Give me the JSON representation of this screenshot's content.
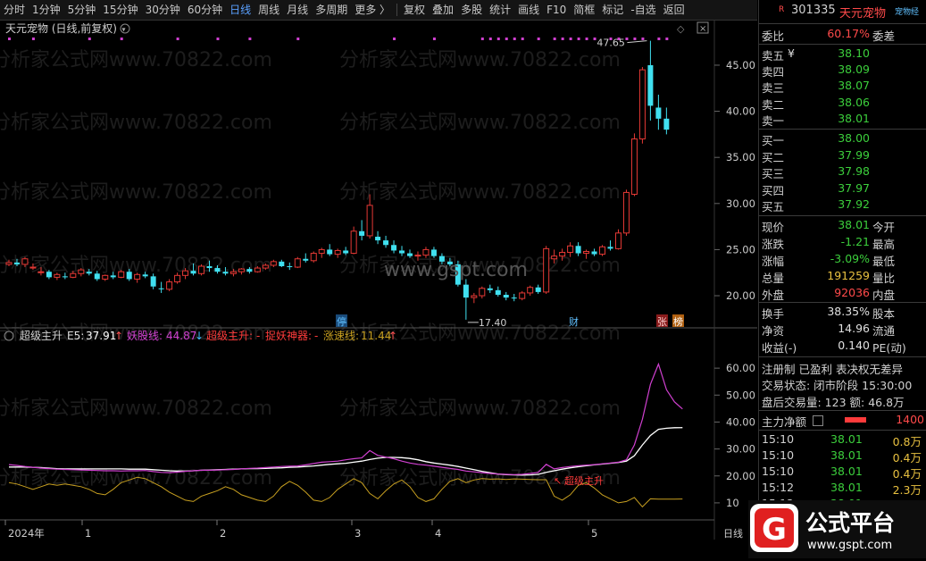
{
  "toolbar": {
    "items": [
      {
        "label": "分时",
        "active": false
      },
      {
        "label": "1分钟",
        "active": false
      },
      {
        "label": "5分钟",
        "active": false
      },
      {
        "label": "15分钟",
        "active": false
      },
      {
        "label": "30分钟",
        "active": false
      },
      {
        "label": "60分钟",
        "active": false
      },
      {
        "label": "日线",
        "active": true
      },
      {
        "label": "周线",
        "active": false
      },
      {
        "label": "月线",
        "active": false
      },
      {
        "label": "多周期",
        "active": false
      },
      {
        "label": "更多 〉",
        "active": false
      }
    ],
    "right_items": [
      "复权",
      "叠加",
      "多股",
      "统计",
      "画线",
      "F10",
      "简框",
      "标记",
      "-自选",
      "返回"
    ]
  },
  "chart_title": "天元宠物 (日线,前复权)",
  "watermark": "分析家公式网www.70822.com",
  "center_watermark": "www.gspt.com",
  "price_axis": [
    "45.00",
    "40.00",
    "35.00",
    "30.00",
    "25.00",
    "20.00"
  ],
  "high_label": "47.65",
  "low_label": "17.40",
  "markers": {
    "ting": "停",
    "cai": "财",
    "zhang": "张",
    "bang": "榜"
  },
  "indicator": {
    "name": "超级主升",
    "e5_label": "E5:",
    "e5_value": "37.91",
    "yao_label": "妖股线:",
    "yao_value": "44.87",
    "zs_label": "超级主升:",
    "zs_value": "-",
    "zy_label": "捉妖神器:",
    "zy_value": "-",
    "zs2_label": "涨速线:",
    "zs2_value": "11.44",
    "annotation": "超级主升",
    "axis": [
      "60.00",
      "50.00",
      "40.00",
      "30.00",
      "20.00",
      "10"
    ]
  },
  "date_axis": [
    "2024年",
    "1",
    "2",
    "3",
    "4",
    "5"
  ],
  "date_axis_right": "日线",
  "colors": {
    "up": "#e53935",
    "down": "#40e0f0",
    "bg": "#000000",
    "yao": "#d040d0",
    "e5": "#ffffff",
    "zsx": "#c8a020"
  },
  "sidebar": {
    "code": "301335",
    "name": "天元宠物",
    "r_badge": "R",
    "extra": "宠物经",
    "weibi_label": "委比",
    "weibi": "60.17%",
    "weicha_label": "委差",
    "asks": [
      {
        "label": "卖五",
        "mark": "¥",
        "price": "38.10"
      },
      {
        "label": "卖四",
        "mark": "",
        "price": "38.09"
      },
      {
        "label": "卖三",
        "mark": "",
        "price": "38.07"
      },
      {
        "label": "卖二",
        "mark": "",
        "price": "38.06"
      },
      {
        "label": "卖一",
        "mark": "",
        "price": "38.01"
      }
    ],
    "bids": [
      {
        "label": "买一",
        "price": "38.00"
      },
      {
        "label": "买二",
        "price": "37.99"
      },
      {
        "label": "买三",
        "price": "37.98"
      },
      {
        "label": "买四",
        "price": "37.97"
      },
      {
        "label": "买五",
        "price": "37.92"
      }
    ],
    "stats": [
      {
        "l": "现价",
        "v": "38.01",
        "c": "green",
        "r": "今开"
      },
      {
        "l": "涨跌",
        "v": "-1.21",
        "c": "green",
        "r": "最高"
      },
      {
        "l": "涨幅",
        "v": "-3.09%",
        "c": "green",
        "r": "最低"
      },
      {
        "l": "总量",
        "v": "191259",
        "c": "yellow",
        "r": "量比"
      },
      {
        "l": "外盘",
        "v": "92036",
        "c": "red",
        "r": "内盘"
      }
    ],
    "stats2": [
      {
        "l": "换手",
        "v": "38.35%",
        "c": "white",
        "r": "股本"
      },
      {
        "l": "净资",
        "v": "14.96",
        "c": "white",
        "r": "流通"
      },
      {
        "l": "收益(-)",
        "v": "0.140",
        "c": "white",
        "r": "PE(动)"
      }
    ],
    "reg_line": "注册制  已盈利  表决权无差异",
    "trade_state": "交易状态: 闭市阶段 15:30:00",
    "after_hours": "盘后交易量: 123   额: 46.8万",
    "main_flow_label": "主力净额",
    "main_flow_value": "1400",
    "ticks": [
      {
        "t": "15:10",
        "p": "38.01",
        "v": "0.8万"
      },
      {
        "t": "15:10",
        "p": "38.01",
        "v": "0.4万"
      },
      {
        "t": "15:10",
        "p": "38.01",
        "v": "0.4万"
      },
      {
        "t": "15:12",
        "p": "38.01",
        "v": "2.3万"
      },
      {
        "t": "15:12",
        "p": "38.01",
        "v": "0.8万"
      }
    ]
  },
  "logo": {
    "main": "公式平台",
    "url": "www.gspt.com",
    "glyph": "G"
  },
  "chart_data": {
    "type": "candlestick",
    "ylim": [
      17,
      48
    ],
    "ohlc": [
      [
        23.4,
        23.9,
        23.2,
        23.6
      ],
      [
        23.6,
        24.0,
        23.2,
        23.4
      ],
      [
        23.4,
        24.2,
        23.1,
        24.0
      ],
      [
        23.0,
        23.5,
        22.8,
        23.1
      ],
      [
        22.5,
        23.1,
        22.2,
        22.6
      ],
      [
        22.6,
        22.8,
        21.8,
        22.0
      ],
      [
        22.0,
        22.5,
        21.7,
        22.3
      ],
      [
        22.1,
        22.5,
        21.8,
        22.0
      ],
      [
        22.0,
        22.7,
        21.9,
        22.4
      ],
      [
        22.4,
        23.0,
        22.1,
        22.8
      ],
      [
        22.6,
        22.9,
        22.2,
        22.4
      ],
      [
        22.4,
        22.7,
        21.6,
        21.8
      ],
      [
        21.8,
        22.3,
        21.6,
        22.2
      ],
      [
        22.2,
        22.6,
        21.8,
        22.0
      ],
      [
        22.0,
        22.8,
        21.9,
        22.6
      ],
      [
        22.6,
        22.9,
        21.6,
        21.8
      ],
      [
        21.8,
        22.5,
        21.4,
        22.3
      ],
      [
        22.3,
        22.6,
        21.9,
        22.1
      ],
      [
        22.1,
        22.4,
        20.7,
        21.0
      ],
      [
        20.8,
        21.5,
        20.3,
        20.7
      ],
      [
        20.7,
        21.8,
        20.5,
        21.5
      ],
      [
        21.5,
        22.5,
        21.3,
        22.2
      ],
      [
        22.2,
        23.0,
        21.8,
        22.7
      ],
      [
        22.7,
        23.5,
        22.2,
        22.4
      ],
      [
        22.4,
        23.4,
        22.2,
        23.2
      ],
      [
        23.2,
        23.8,
        22.6,
        23.0
      ],
      [
        23.0,
        23.3,
        22.4,
        22.6
      ],
      [
        22.6,
        23.1,
        22.2,
        22.4
      ],
      [
        22.4,
        22.9,
        22.1,
        22.6
      ],
      [
        22.6,
        23.0,
        22.3,
        22.9
      ],
      [
        22.9,
        23.1,
        22.4,
        22.6
      ],
      [
        22.6,
        23.2,
        22.5,
        23.0
      ],
      [
        23.0,
        23.5,
        22.8,
        23.3
      ],
      [
        23.3,
        23.9,
        23.1,
        23.7
      ],
      [
        23.7,
        23.9,
        23.1,
        23.2
      ],
      [
        23.2,
        23.6,
        22.8,
        23.1
      ],
      [
        23.1,
        24.2,
        23.0,
        24.0
      ],
      [
        24.0,
        24.6,
        23.6,
        23.8
      ],
      [
        23.8,
        24.8,
        23.6,
        24.6
      ],
      [
        24.6,
        25.2,
        24.1,
        25.0
      ],
      [
        25.0,
        25.6,
        24.3,
        24.5
      ],
      [
        24.5,
        25.1,
        24.1,
        24.9
      ],
      [
        24.9,
        25.3,
        24.4,
        24.6
      ],
      [
        24.6,
        27.5,
        24.5,
        27.0
      ],
      [
        27.0,
        28.2,
        26.0,
        26.5
      ],
      [
        26.5,
        31.0,
        26.2,
        29.8
      ],
      [
        26.4,
        27.0,
        25.6,
        26.0
      ],
      [
        26.0,
        26.5,
        25.2,
        25.5
      ],
      [
        25.5,
        26.0,
        24.6,
        24.9
      ],
      [
        24.9,
        25.4,
        24.3,
        24.6
      ],
      [
        24.6,
        25.0,
        24.1,
        24.3
      ],
      [
        24.3,
        24.8,
        23.8,
        24.4
      ],
      [
        24.4,
        25.3,
        24.1,
        25.0
      ],
      [
        25.0,
        25.3,
        24.1,
        24.3
      ],
      [
        24.3,
        24.6,
        23.4,
        23.7
      ],
      [
        23.7,
        24.1,
        23.2,
        23.4
      ],
      [
        23.4,
        23.8,
        21.0,
        21.2
      ],
      [
        21.2,
        21.8,
        17.4,
        19.8
      ],
      [
        19.8,
        20.3,
        19.2,
        20.0
      ],
      [
        20.0,
        21.0,
        19.7,
        20.8
      ],
      [
        20.8,
        21.2,
        20.3,
        20.6
      ],
      [
        20.6,
        21.0,
        19.9,
        20.1
      ],
      [
        20.1,
        20.4,
        19.5,
        19.8
      ],
      [
        19.8,
        20.2,
        19.4,
        19.7
      ],
      [
        19.7,
        20.5,
        19.5,
        20.3
      ],
      [
        20.3,
        21.1,
        20.0,
        20.9
      ],
      [
        20.9,
        21.2,
        20.2,
        20.4
      ],
      [
        20.4,
        25.4,
        20.2,
        25.1
      ],
      [
        24.0,
        25.0,
        23.5,
        24.3
      ],
      [
        24.3,
        25.1,
        23.8,
        24.7
      ],
      [
        24.7,
        25.8,
        24.2,
        25.4
      ],
      [
        25.4,
        25.8,
        24.3,
        24.6
      ],
      [
        24.6,
        25.0,
        24.0,
        24.8
      ],
      [
        24.8,
        25.1,
        24.3,
        24.5
      ],
      [
        24.5,
        25.5,
        24.3,
        25.3
      ],
      [
        25.3,
        26.0,
        24.9,
        25.1
      ],
      [
        25.1,
        27.2,
        25.0,
        26.8
      ],
      [
        26.8,
        31.5,
        26.5,
        31.2
      ],
      [
        31.0,
        37.6,
        30.8,
        37.0
      ],
      [
        37.0,
        44.8,
        36.5,
        44.5
      ],
      [
        45.0,
        47.65,
        39.0,
        40.6
      ],
      [
        40.4,
        41.8,
        38.0,
        39.2
      ],
      [
        39.2,
        40.4,
        37.5,
        38.01
      ]
    ],
    "indicator_ylim": [
      5,
      68
    ],
    "yao": [
      24.2,
      23.9,
      23.5,
      23.2,
      22.9,
      22.7,
      22.5,
      22.4,
      22.3,
      22.2,
      22.1,
      22.0,
      21.9,
      21.9,
      21.8,
      21.9,
      21.9,
      22.0,
      21.6,
      21.3,
      21.2,
      21.4,
      21.7,
      21.9,
      22.1,
      22.1,
      22.2,
      22.3,
      22.4,
      22.6,
      22.8,
      22.9,
      23.1,
      23.3,
      23.5,
      23.6,
      23.7,
      24.1,
      24.6,
      25.1,
      25.3,
      25.5,
      26.0,
      26.4,
      26.7,
      29.4,
      27.6,
      27.0,
      26.4,
      25.5,
      24.8,
      24.3,
      24.0,
      23.6,
      23.2,
      22.8,
      22.4,
      21.8,
      21.5,
      21.2,
      20.9,
      20.7,
      20.6,
      20.5,
      20.6,
      20.9,
      21.3,
      24.3,
      22.6,
      23.1,
      23.5,
      23.8,
      24.0,
      24.2,
      24.5,
      24.8,
      25.1,
      26.0,
      31.5,
      41.0,
      54.0,
      61.5,
      52.0,
      47.5,
      44.87
    ],
    "e5": [
      23.3,
      23.3,
      23.3,
      23.2,
      23.1,
      22.9,
      22.7,
      22.6,
      22.6,
      22.6,
      22.6,
      22.6,
      22.6,
      22.6,
      22.6,
      22.5,
      22.5,
      22.5,
      22.3,
      22.1,
      21.9,
      21.8,
      21.8,
      21.9,
      22.1,
      22.2,
      22.3,
      22.4,
      22.5,
      22.6,
      22.7,
      22.7,
      22.8,
      22.9,
      23.0,
      23.2,
      23.3,
      23.5,
      23.7,
      24.0,
      24.3,
      24.5,
      24.7,
      25.1,
      25.5,
      26.1,
      26.6,
      26.9,
      26.9,
      26.8,
      26.5,
      26.0,
      25.3,
      24.8,
      24.4,
      24.0,
      23.5,
      22.9,
      22.3,
      21.7,
      21.2,
      20.7,
      20.5,
      20.4,
      20.3,
      20.4,
      20.6,
      21.3,
      21.9,
      22.5,
      23.0,
      23.4,
      23.8,
      24.1,
      24.4,
      24.7,
      25.0,
      25.5,
      27.5,
      31.5,
      35.0,
      37.3,
      37.7,
      37.9,
      37.91
    ],
    "zsx": [
      17.5,
      17.0,
      16.0,
      15.0,
      16.0,
      17.0,
      16.5,
      17.0,
      16.5,
      16.0,
      15.0,
      13.5,
      13.0,
      15.0,
      17.5,
      18.5,
      19.5,
      19.0,
      17.5,
      16.0,
      14.0,
      12.5,
      11.0,
      10.5,
      12.5,
      13.5,
      14.5,
      16.0,
      15.0,
      13.0,
      12.0,
      11.0,
      10.5,
      12.5,
      16.0,
      18.0,
      16.5,
      14.0,
      11.0,
      10.5,
      12.0,
      15.0,
      17.0,
      19.0,
      17.5,
      13.5,
      11.5,
      14.5,
      17.0,
      18.5,
      16.0,
      12.0,
      10.5,
      11.5,
      15.0,
      18.0,
      19.0,
      17.5,
      18.5,
      19.0,
      18.8,
      18.9,
      18.7,
      18.9,
      18.8,
      18.7,
      18.6,
      18.6,
      12.5,
      11.0,
      13.0,
      16.5,
      17.5,
      15.5,
      13.0,
      11.5,
      10.0,
      10.5,
      12.0,
      8.5,
      11.5,
      11.4,
      11.4,
      11.4,
      11.44
    ]
  }
}
